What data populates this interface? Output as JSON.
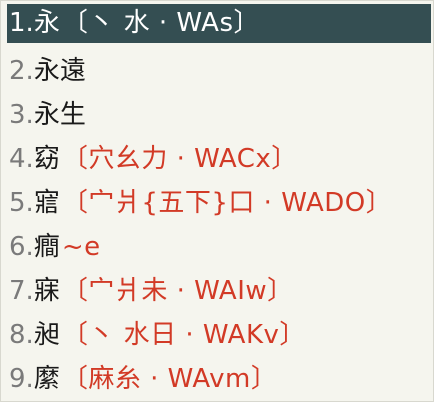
{
  "candidates": [
    {
      "num": "1.",
      "char": "永",
      "hint": "〔丶 水 · WAs〕",
      "selected": true
    },
    {
      "num": "2.",
      "char": "永遠",
      "hint": ""
    },
    {
      "num": "3.",
      "char": "永生",
      "hint": ""
    },
    {
      "num": "4.",
      "char": "窈",
      "hint": "〔穴幺力 · WACx〕"
    },
    {
      "num": "5.",
      "char": "寣",
      "hint": "〔宀爿{五下}口 · WADO〕"
    },
    {
      "num": "6.",
      "char": "癎",
      "hint": "~e"
    },
    {
      "num": "7.",
      "char": "寐",
      "hint": "〔宀爿未 · WAIw〕"
    },
    {
      "num": "8.",
      "char": "昶",
      "hint": "〔丶 水日 · WAKv〕"
    },
    {
      "num": "9.",
      "char": "縻",
      "hint": "〔麻糸 · WAvm〕"
    }
  ],
  "colors": {
    "background": "#f5f5ee",
    "selected_background": "#344e52",
    "hint_text": "#d23a26",
    "index_text": "#7a7a7a"
  }
}
